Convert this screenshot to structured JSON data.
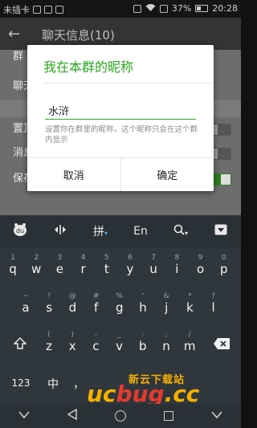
{
  "status_bar": {
    "carrier": "未插卡",
    "battery_percent": "37%",
    "battery_level": 0.37,
    "time": "20:28"
  },
  "app_bar": {
    "back_icon": "arrow-left-icon",
    "title": "聊天信息(10)"
  },
  "background_list": {
    "items": [
      {
        "label": "群聊名称",
        "partial": "群"
      },
      {
        "label": "聊天",
        "partial": "聊天"
      },
      {
        "label": "置顶聊天",
        "partial": "置顶"
      },
      {
        "label": "消息免打扰",
        "partial": "消息"
      },
      {
        "label": "保存到通讯录"
      }
    ]
  },
  "dialog": {
    "title": "我在本群的昵称",
    "input_value": "水浒",
    "hint": "设置你在群里的昵称，这个昵称只会在这个群内显示",
    "cancel_label": "取消",
    "confirm_label": "确定",
    "accent_color": "#2aa51c"
  },
  "keyboard": {
    "toolbar": {
      "logo": "du",
      "cursor_icon": "cursor-move-icon",
      "ime_label": "拼",
      "ime_caret": "▾",
      "lang_label": "En",
      "search_icon": "search-icon",
      "search_caret": "▾",
      "hide_icon": "hide-keyboard-icon"
    },
    "row1": [
      {
        "k": "q",
        "h": "1"
      },
      {
        "k": "w",
        "h": "2"
      },
      {
        "k": "e",
        "h": "3"
      },
      {
        "k": "r",
        "h": "4"
      },
      {
        "k": "t",
        "h": "5"
      },
      {
        "k": "y",
        "h": "6"
      },
      {
        "k": "u",
        "h": "7"
      },
      {
        "k": "i",
        "h": "8"
      },
      {
        "k": "o",
        "h": "9"
      },
      {
        "k": "p",
        "h": "0"
      }
    ],
    "row2": [
      {
        "k": "a",
        "h": "~"
      },
      {
        "k": "s",
        "h": "!"
      },
      {
        "k": "d",
        "h": "@"
      },
      {
        "k": "f",
        "h": "#"
      },
      {
        "k": "g",
        "h": "%"
      },
      {
        "k": "h",
        "h": "'"
      },
      {
        "k": "j",
        "h": "&"
      },
      {
        "k": "k",
        "h": "*"
      },
      {
        "k": "l",
        "h": "?"
      }
    ],
    "row3": [
      {
        "k": "z",
        "h": "("
      },
      {
        "k": "x",
        "h": ")"
      },
      {
        "k": "c",
        "h": "-"
      },
      {
        "k": "v",
        "h": "_"
      },
      {
        "k": "b",
        "h": ":"
      },
      {
        "k": "n",
        "h": ";"
      },
      {
        "k": "m",
        "h": "/"
      }
    ],
    "shift_icon": "shift-icon",
    "backspace_icon": "backspace-icon",
    "bottom_row": {
      "numbers_label": "123",
      "cn_label": "中",
      "comma_label": "，"
    }
  },
  "nav_bar": {
    "back_icon": "nav-back-icon",
    "home_icon": "nav-home-icon",
    "recents_icon": "nav-recents-icon",
    "notif_icon": "nav-notification-icon"
  },
  "watermark": {
    "cn_text": "新云下载站",
    "text": "ucbug.cc",
    "color_uc": "#f6b000",
    "color_bug": "#e53b2c"
  }
}
